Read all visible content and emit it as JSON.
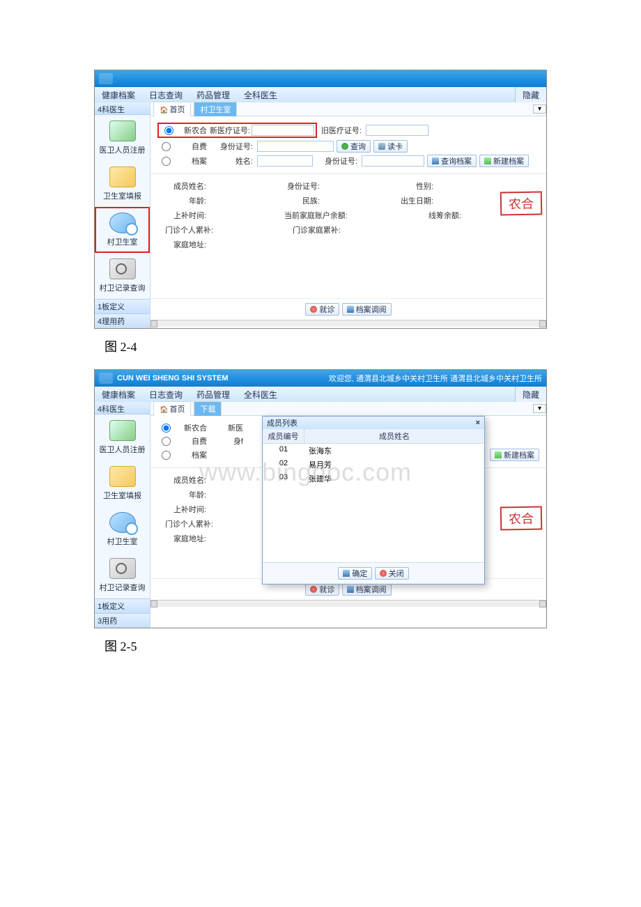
{
  "caption1": "图 2-4",
  "caption2": "图 2-5",
  "system_title": "CUN WEI SHENG SHI SYSTEM",
  "welcome": "欢迎您,  通渭县北城乡中关村卫生所  通渭县北城乡中关村卫生所",
  "menu": {
    "m1": "健康档案",
    "m2": "日志查询",
    "m3": "药品管理",
    "m4": "全科医生",
    "hide": "隐藏"
  },
  "sidebar": {
    "header": "4科医生",
    "items": [
      "医卫人员注册",
      "卫生室填报",
      "村卫生室",
      "村卫记录查询"
    ],
    "b1": "1板定义",
    "b1b": "1板定义",
    "b2": "4理用药",
    "b2b": "3用药"
  },
  "tabs": {
    "home": "首页",
    "active": "村卫生室",
    "active2": "下载"
  },
  "form": {
    "r1": {
      "opt": "新农合",
      "lbl": "新医疗证号:",
      "lbl2": "旧医疗证号:"
    },
    "r2": {
      "opt": "自费",
      "lbl": "身份证号:",
      "btn_query": "查询",
      "btn_card": "读卡"
    },
    "r3": {
      "opt": "档案",
      "lbl": "姓名:",
      "lbl2": "身份证号:",
      "btn_q": "查询档案",
      "btn_n": "新建档案"
    }
  },
  "info": {
    "name": "成员姓名:",
    "id": "身份证号:",
    "sex": "性别:",
    "age": "年龄:",
    "nation": "民族:",
    "birth": "出生日期:",
    "uptime": "上补时间:",
    "balance": "当前家庭账户余额:",
    "left": "线筹余额:",
    "p1": "门诊个人累补:",
    "p2": "门诊家庭累补:",
    "addr": "家庭地址:"
  },
  "footer": {
    "b1": "就诊",
    "b2": "档案调阅"
  },
  "stamp": "农合",
  "dialog": {
    "title": "成员列表",
    "col1": "成员编号",
    "col2": "成员姓名",
    "rows": [
      {
        "no": "01",
        "name": "张海东"
      },
      {
        "no": "02",
        "name": "易月芳"
      },
      {
        "no": "03",
        "name": "张建华"
      }
    ],
    "ok": "确定",
    "close": "关闭"
  },
  "watermark": "www.bingdoc.com"
}
